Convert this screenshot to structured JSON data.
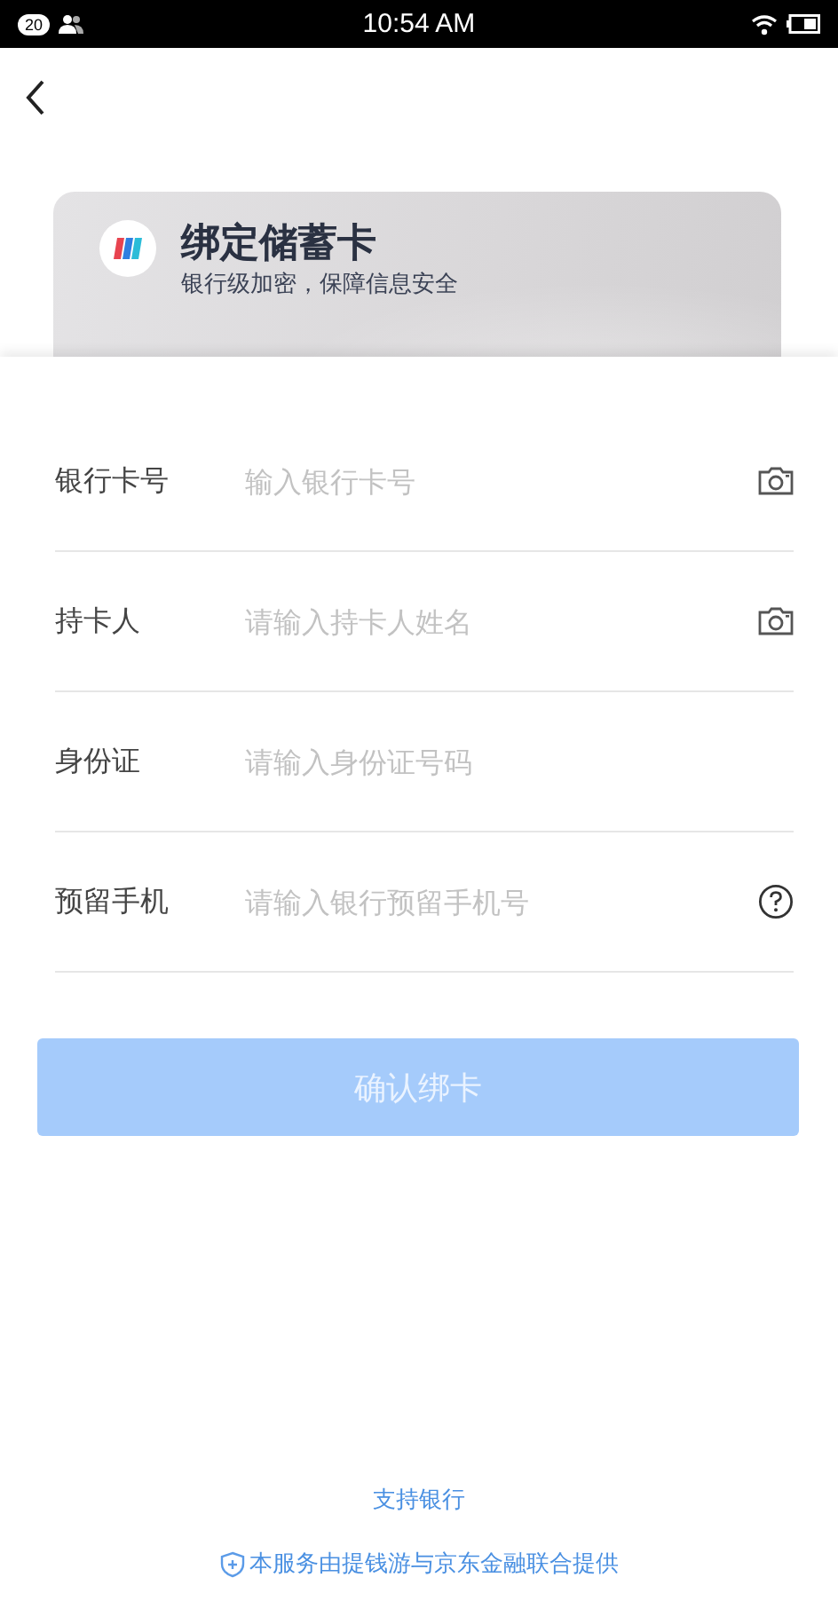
{
  "status_bar": {
    "badge": "20",
    "time": "10:54 AM"
  },
  "card": {
    "title": "绑定储蓄卡",
    "subtitle": "银行级加密，保障信息安全"
  },
  "fields": [
    {
      "label": "银行卡号",
      "placeholder": "输入银行卡号",
      "kind": "camera"
    },
    {
      "label": "持卡人",
      "placeholder": "请输入持卡人姓名",
      "kind": "camera"
    },
    {
      "label": "身份证",
      "placeholder": "请输入身份证号码"
    },
    {
      "label": "预留手机",
      "placeholder": "请输入银行预留手机号",
      "kind": "help"
    }
  ],
  "submit": {
    "label": "确认绑卡",
    "disabled": true
  },
  "footer": {
    "link": "支持银行",
    "note": "本服务由提钱游与京东金融联合提供"
  }
}
